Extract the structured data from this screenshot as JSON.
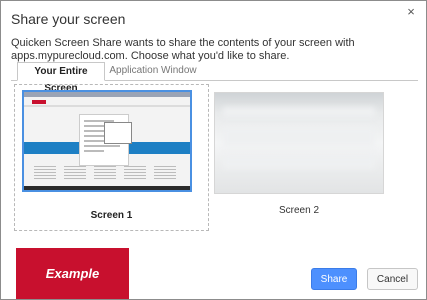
{
  "dialog": {
    "title": "Share your screen",
    "close_glyph": "×",
    "message": "Quicken Screen Share wants to share the contents of your screen with apps.mypurecloud.com. Choose what you'd like to share."
  },
  "tabs": [
    {
      "label": "Your Entire Screen",
      "active": true
    },
    {
      "label": "Application Window",
      "active": false
    }
  ],
  "screens": [
    {
      "caption": "Screen 1",
      "selected": true
    },
    {
      "caption": "Screen 2",
      "selected": false
    }
  ],
  "overlay": {
    "label": "Example",
    "color": "#c8102e"
  },
  "buttons": {
    "share": "Share",
    "cancel": "Cancel"
  },
  "colors": {
    "accent": "#4d90fe",
    "selection_border": "#4a90e2"
  }
}
